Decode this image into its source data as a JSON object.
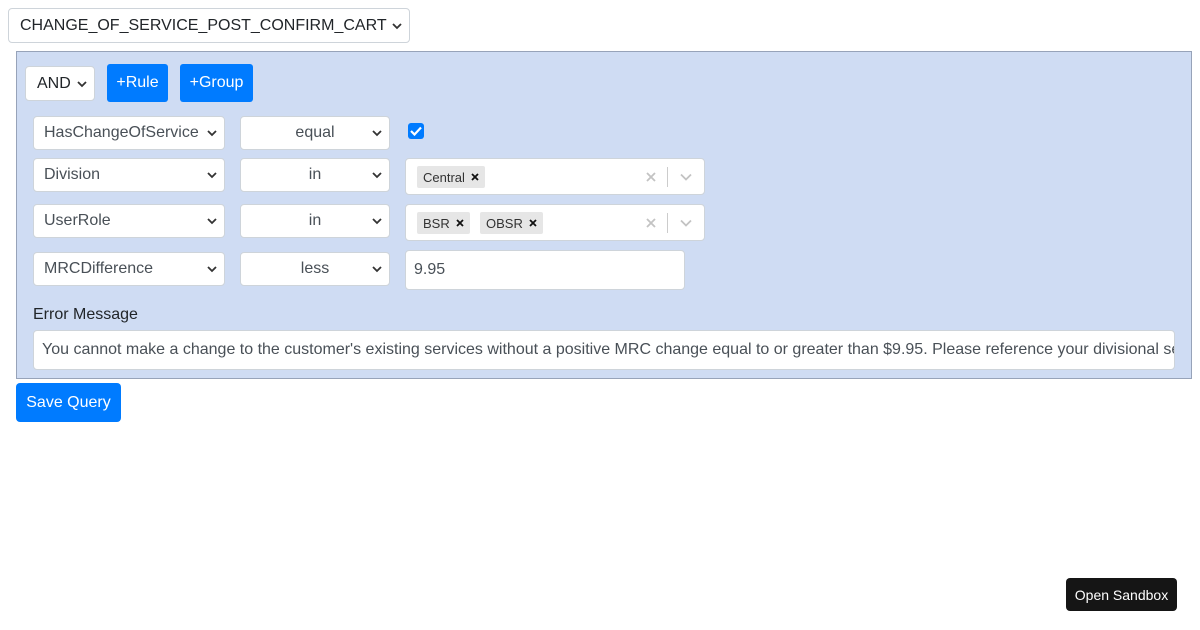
{
  "rule_set_select": {
    "value": "CHANGE_OF_SERVICE_POST_CONFIRM_CART"
  },
  "group": {
    "combinator": "AND",
    "add_rule_label": "+Rule",
    "add_group_label": "+Group"
  },
  "rules": [
    {
      "field": "HasChangeOfService",
      "operator": "equal",
      "checked": true
    },
    {
      "field": "Division",
      "operator": "in",
      "values": [
        "Central"
      ]
    },
    {
      "field": "UserRole",
      "operator": "in",
      "values": [
        "BSR",
        "OBSR"
      ]
    },
    {
      "field": "MRCDifference",
      "operator": "less",
      "value": "9.95"
    }
  ],
  "error_message": {
    "label": "Error Message",
    "value": "You cannot make a change to the customer's existing services without a positive MRC change equal to or greater than $9.95. Please reference your divisional service guide"
  },
  "save_label": "Save Query",
  "sandbox_label": "Open Sandbox",
  "colors": {
    "primary": "#007bff",
    "panel": "#cfdcf3",
    "panel_border": "#97a3b9"
  }
}
